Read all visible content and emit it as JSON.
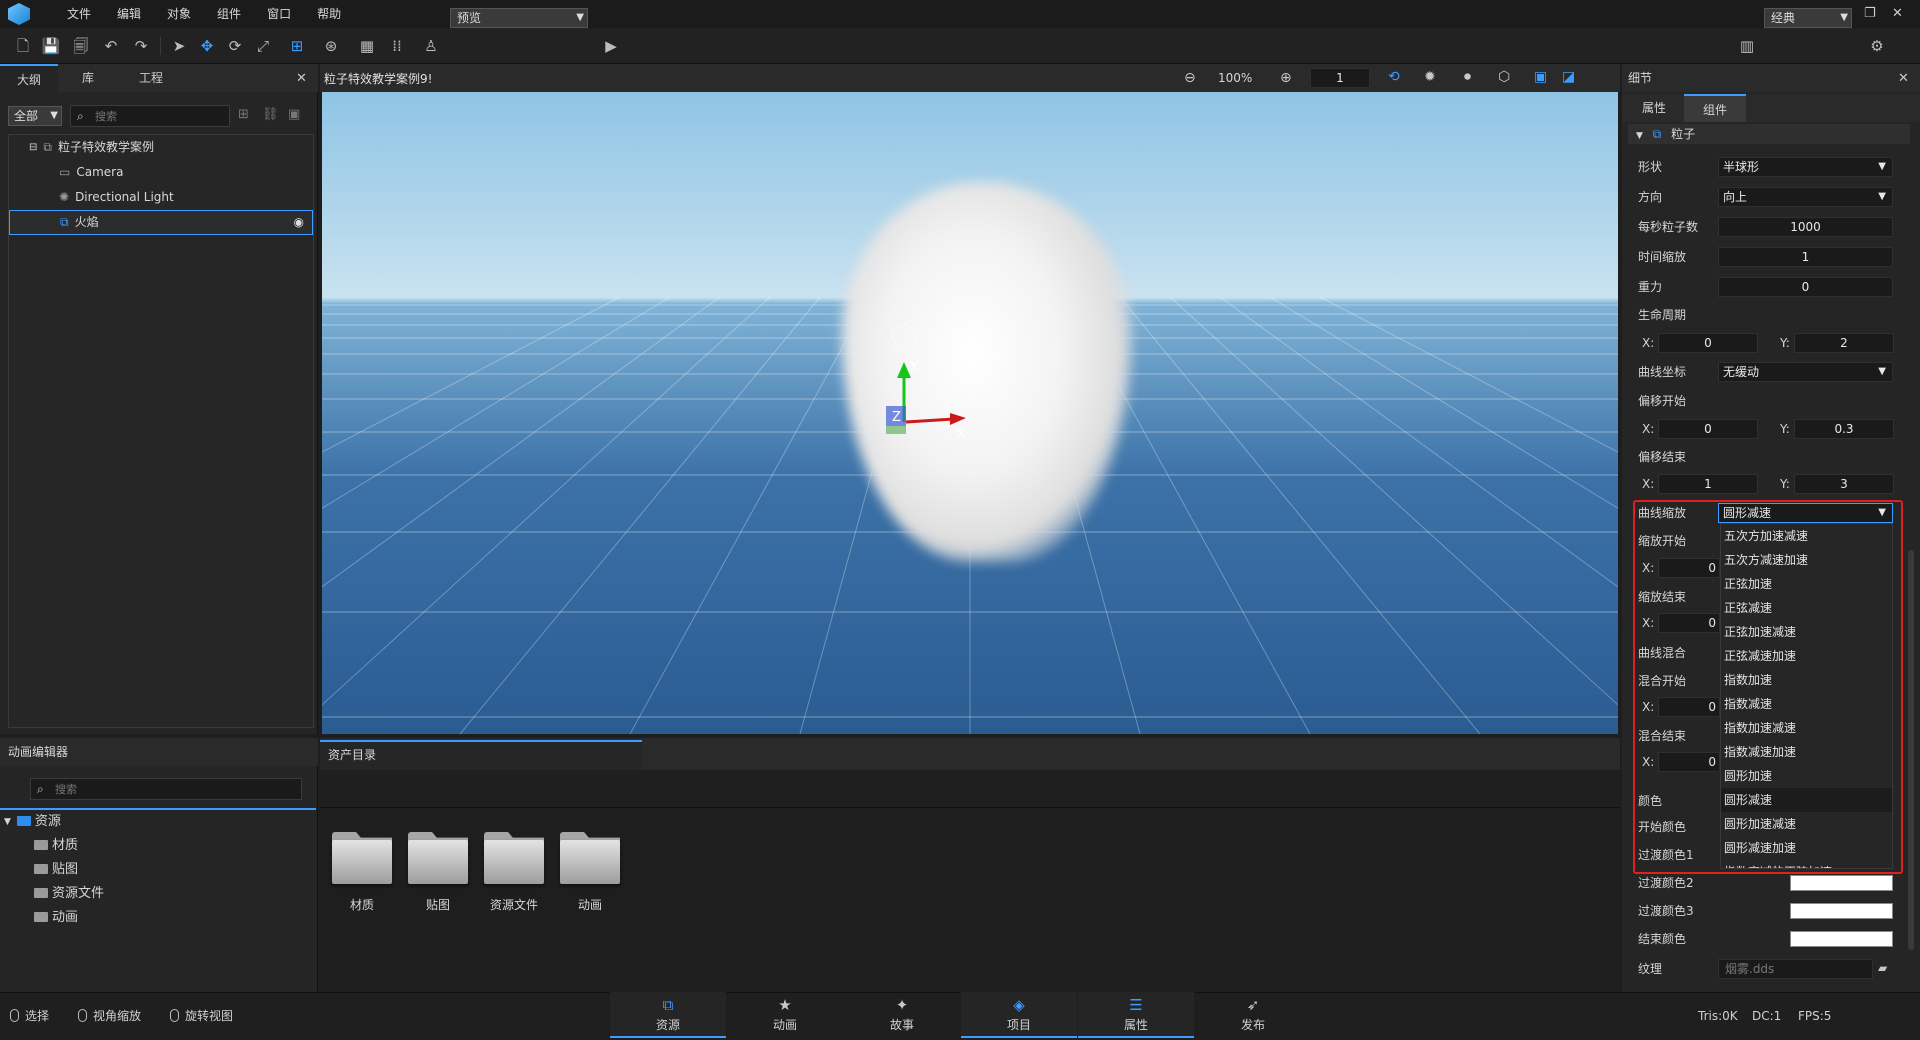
{
  "menu": [
    "文件",
    "编辑",
    "对象",
    "组件",
    "窗口",
    "帮助"
  ],
  "toolbar": {
    "preview_label": "预览",
    "theme_label": "经典"
  },
  "left_panel": {
    "tabs": [
      "大纲",
      "库",
      "工程"
    ],
    "filter_value": "全部",
    "search_placeholder": "搜索",
    "tree": [
      {
        "label": "粒子特效教学案例"
      },
      {
        "label": "Camera"
      },
      {
        "label": "Directional Light"
      },
      {
        "label": "火焰"
      }
    ]
  },
  "viewport": {
    "title": "粒子特效教学案例9!",
    "zoom": "100%",
    "speed_value": "1"
  },
  "anim_panel": {
    "title": "动画编辑器",
    "search_placeholder": "搜索",
    "root": "资源",
    "children": [
      "材质",
      "贴图",
      "资源文件",
      "动画"
    ]
  },
  "assets": {
    "tab_label": "资产目录",
    "folders": [
      "材质",
      "贴图",
      "资源文件",
      "动画"
    ]
  },
  "details": {
    "title": "细节",
    "tabs": [
      "属性",
      "组件"
    ],
    "section": "粒子",
    "shape_label": "形状",
    "shape_value": "半球形",
    "direction_label": "方向",
    "direction_value": "向上",
    "rate_label": "每秒粒子数",
    "rate_value": "1000",
    "timescale_label": "时间缩放",
    "timescale_value": "1",
    "gravity_label": "重力",
    "gravity_value": "0",
    "lifetime_label": "生命周期",
    "lifetime_x": "0",
    "lifetime_y": "2",
    "curve_coord_label": "曲线坐标",
    "curve_coord_value": "无缓动",
    "offset_start_label": "偏移开始",
    "offset_start_x": "0",
    "offset_start_y": "0.3",
    "offset_end_label": "偏移结束",
    "offset_end_x": "1",
    "offset_end_y": "3",
    "curve_scale_label": "曲线缩放",
    "curve_scale_value": "圆形减速",
    "scale_start_label": "缩放开始",
    "scale_start_x": "0",
    "scale_end_label": "缩放结束",
    "scale_end_x": "0",
    "curve_blend_label": "曲线混合",
    "blend_start_label": "混合开始",
    "blend_start_x": "0",
    "blend_end_label": "混合结束",
    "blend_end_x": "0",
    "color_label": "颜色",
    "start_color_label": "开始颜色",
    "trans_color1_label": "过渡颜色1",
    "trans_color2_label": "过渡颜色2",
    "trans_color3_label": "过渡颜色3",
    "end_color_label": "结束颜色",
    "texture_label": "纹理",
    "texture_value": "烟雾.dds",
    "x_label": "X:",
    "y_label": "Y:"
  },
  "dropdown_options": [
    "五次方加速减速",
    "五次方减速加速",
    "正弦加速",
    "正弦减速",
    "正弦加速减速",
    "正弦减速加速",
    "指数加速",
    "指数减速",
    "指数加速减速",
    "指数减速加速",
    "圆形加速",
    "圆形减速",
    "圆形加速减速",
    "圆形减速加速",
    "指数衰减的正弦加速"
  ],
  "dropdown_selected": "圆形减速",
  "status": {
    "select": "选择",
    "view_zoom": "视角缩放",
    "rotate_view": "旋转视图",
    "tris": "Tris:0K",
    "dc": "DC:1",
    "fps": "FPS:5"
  },
  "nav_tabs": [
    "资源",
    "动画",
    "故事",
    "项目",
    "属性",
    "发布"
  ]
}
